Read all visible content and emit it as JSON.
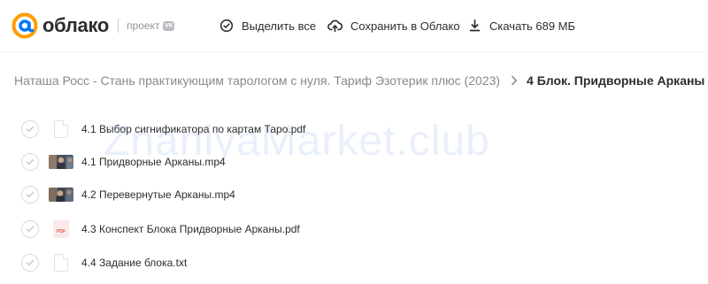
{
  "header": {
    "logo_text": "облако",
    "logo_sub": "проект",
    "logo_badge": "VK",
    "select_all_label": "Выделить все",
    "save_label": "Сохранить в Облако",
    "download_label": "Скачать 689 МБ"
  },
  "breadcrumb": {
    "parent": "Наташа Росс - Стань практикующим тарологом с нуля. Тариф Эзотерик плюс (2023)",
    "current": "4 Блок. Придворные Арканы"
  },
  "watermark": "ZnaniyaMarket.club",
  "files": [
    {
      "name": "4.1 Выбор сигнификатора по картам Таро.pdf",
      "icon": "document-icon"
    },
    {
      "name": "4.1 Придворные Арканы.mp4",
      "icon": "video-thumbnail"
    },
    {
      "name": "4.2 Перевернутые Арканы.mp4",
      "icon": "video-thumbnail"
    },
    {
      "name": "4.3 Конспект Блока Придворные Арканы.pdf",
      "icon": "pdf-icon",
      "icon_label": "PDF"
    },
    {
      "name": "4.4 Задание блока.txt",
      "icon": "document-icon"
    }
  ],
  "colors": {
    "brand": "#ff9e00",
    "brand_ring": "#0077ff",
    "text": "#2c2d2e",
    "muted": "#87898f"
  }
}
